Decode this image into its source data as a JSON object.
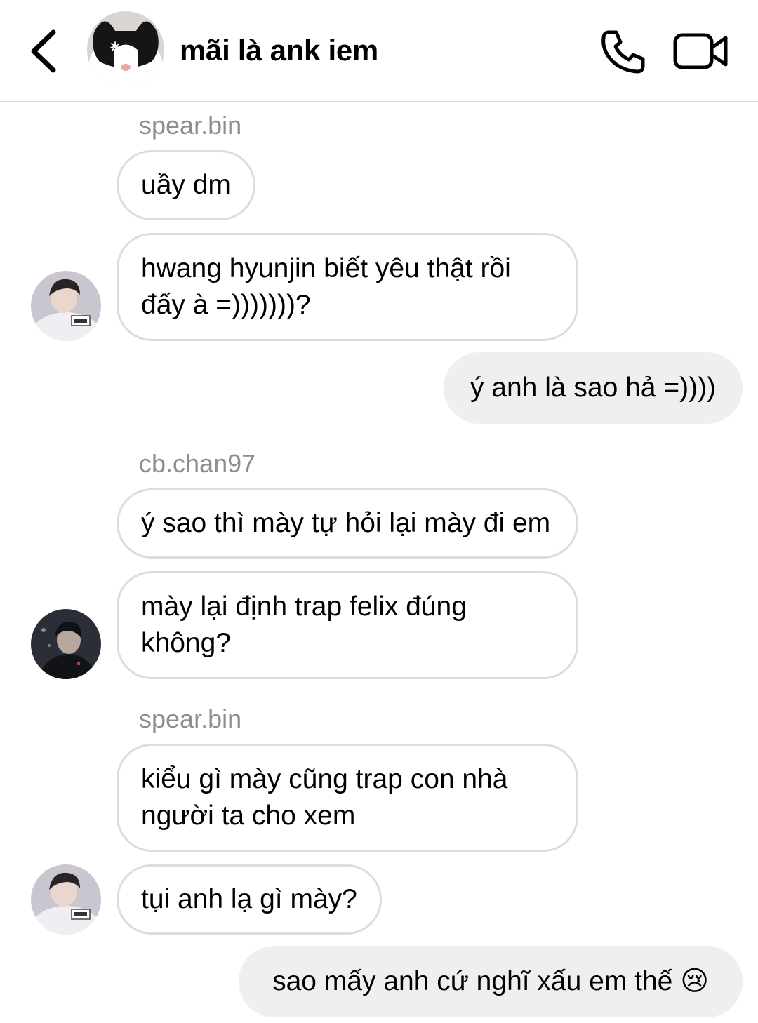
{
  "header": {
    "title": "mãi là ank iem",
    "icons": {
      "back": "chevron-left-icon",
      "call": "phone-icon",
      "video": "video-camera-icon"
    }
  },
  "messages": [
    {
      "sender": "spear.bin"
    },
    {
      "text": "uầy dm",
      "direction": "incoming"
    },
    {
      "text": "hwang hyunjin biết yêu thật rồi đấy à =)))))))?",
      "direction": "incoming"
    },
    {
      "text": "ý anh là sao hả =))))",
      "direction": "outgoing"
    },
    {
      "sender": "cb.chan97"
    },
    {
      "text": "ý sao thì mày tự hỏi lại mày đi em",
      "direction": "incoming"
    },
    {
      "text": "mày lại định trap felix đúng không?",
      "direction": "incoming"
    },
    {
      "sender": "spear.bin"
    },
    {
      "text": "kiểu gì mày cũng trap con nhà người ta cho xem",
      "direction": "incoming"
    },
    {
      "text": "tụi anh lạ gì mày?",
      "direction": "incoming"
    },
    {
      "text": "sao mấy anh cứ nghĩ xấu em thế 😢",
      "direction": "outgoing"
    }
  ],
  "colors": {
    "incoming_border": "#dcdcdc",
    "outgoing_bg": "#efefef",
    "sender_text": "#8e8e8e"
  }
}
